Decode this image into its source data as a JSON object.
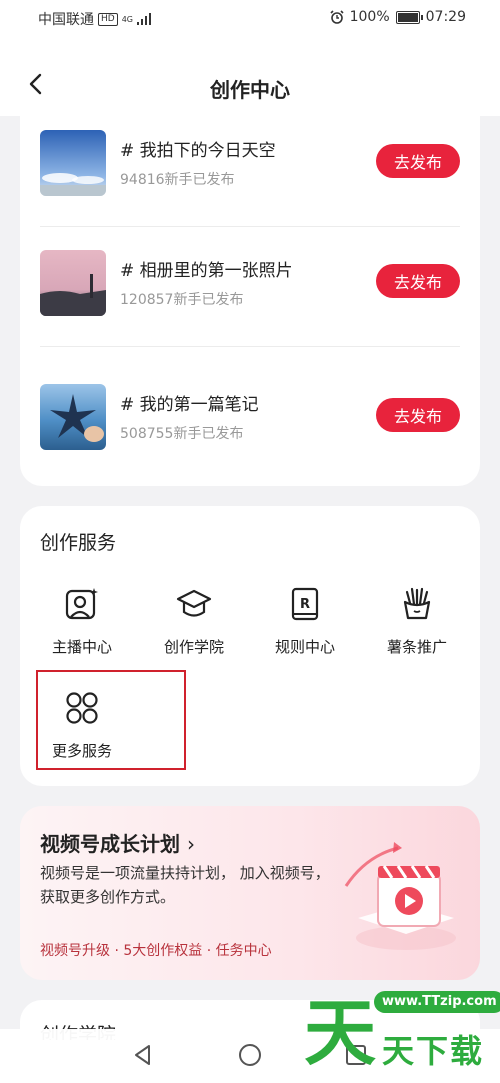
{
  "status_bar": {
    "carrier": "中国联通",
    "hd_badge": "HD",
    "network": "4G",
    "battery": "100%",
    "time": "07:29"
  },
  "header": {
    "title": "创作中心"
  },
  "topics": [
    {
      "title": "# 我拍下的今日天空",
      "subtitle": "94816新手已发布",
      "button": "去发布"
    },
    {
      "title": "# 相册里的第一张照片",
      "subtitle": "120857新手已发布",
      "button": "去发布"
    },
    {
      "title": "# 我的第一篇笔记",
      "subtitle": "508755新手已发布",
      "button": "去发布"
    }
  ],
  "services": {
    "title": "创作服务",
    "items": [
      {
        "label": "主播中心",
        "icon": "anchor-portrait-icon"
      },
      {
        "label": "创作学院",
        "icon": "graduation-cap-icon"
      },
      {
        "label": "规则中心",
        "icon": "rules-book-icon"
      },
      {
        "label": "薯条推广",
        "icon": "fries-icon"
      },
      {
        "label": "更多服务",
        "icon": "more-grid-icon"
      }
    ]
  },
  "growth": {
    "title": "视频号成长计划",
    "description": "视频号是一项流量扶持计划， 加入视频号，获取更多创作方式。",
    "links": "视频号升级 · 5大创作权益 · 任务中心"
  },
  "next_section": {
    "title": "创作学院"
  },
  "watermark": {
    "url": "www.TTzip.com",
    "big": "天",
    "small": "天下载"
  },
  "colors": {
    "accent": "#e8233c",
    "highlight_box": "#d0212d",
    "watermark": "#2eac3e"
  }
}
